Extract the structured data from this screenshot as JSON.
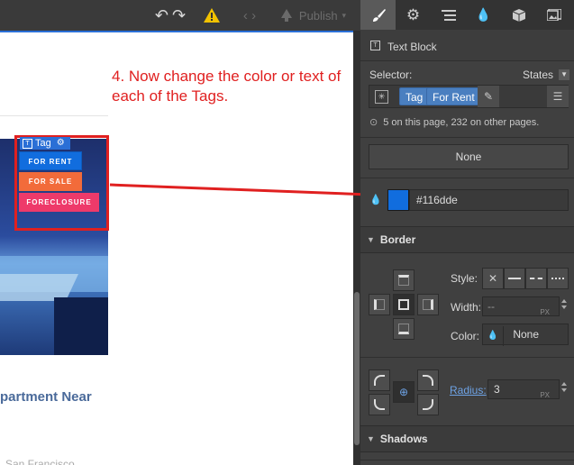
{
  "toolbar": {
    "publish_label": "Publish"
  },
  "panel": {
    "block_title": "Text Block",
    "selector_label": "Selector:",
    "states_label": "States",
    "selector_chips": [
      "Tag",
      "For Rent"
    ],
    "usage_text": "5 on this page, 232 on other pages.",
    "none_label": "None",
    "color_value": "#116dde"
  },
  "border": {
    "section_title": "Border",
    "style_label": "Style:",
    "width_label": "Width:",
    "width_value": "--",
    "width_unit": "PX",
    "color_label": "Color:",
    "color_value": "None",
    "radius_label": "Radius:",
    "radius_value": "3",
    "radius_unit": "PX"
  },
  "shadows": {
    "section_title": "Shadows"
  },
  "canvas": {
    "annotation": "4. Now change the color or text of each of the Tags.",
    "tag_badge": "Tag",
    "tags": [
      "FOR RENT",
      "FOR SALE",
      "FORECLOSURE"
    ],
    "listing_title": "partment Near",
    "listing_subtitle": "San Francisco"
  },
  "colors": {
    "tag_blue": "#116dde",
    "tag_orange": "#f26b3a",
    "tag_pink": "#ee3a6a",
    "highlight_red": "#e02020",
    "panel_bg": "#404040"
  },
  "icons": [
    "undo-icon",
    "redo-icon",
    "warning-icon",
    "code-icon",
    "publish-icon",
    "brush-icon",
    "gear-icon",
    "navigator-icon",
    "drops-icon",
    "box-icon",
    "assets-icon"
  ]
}
